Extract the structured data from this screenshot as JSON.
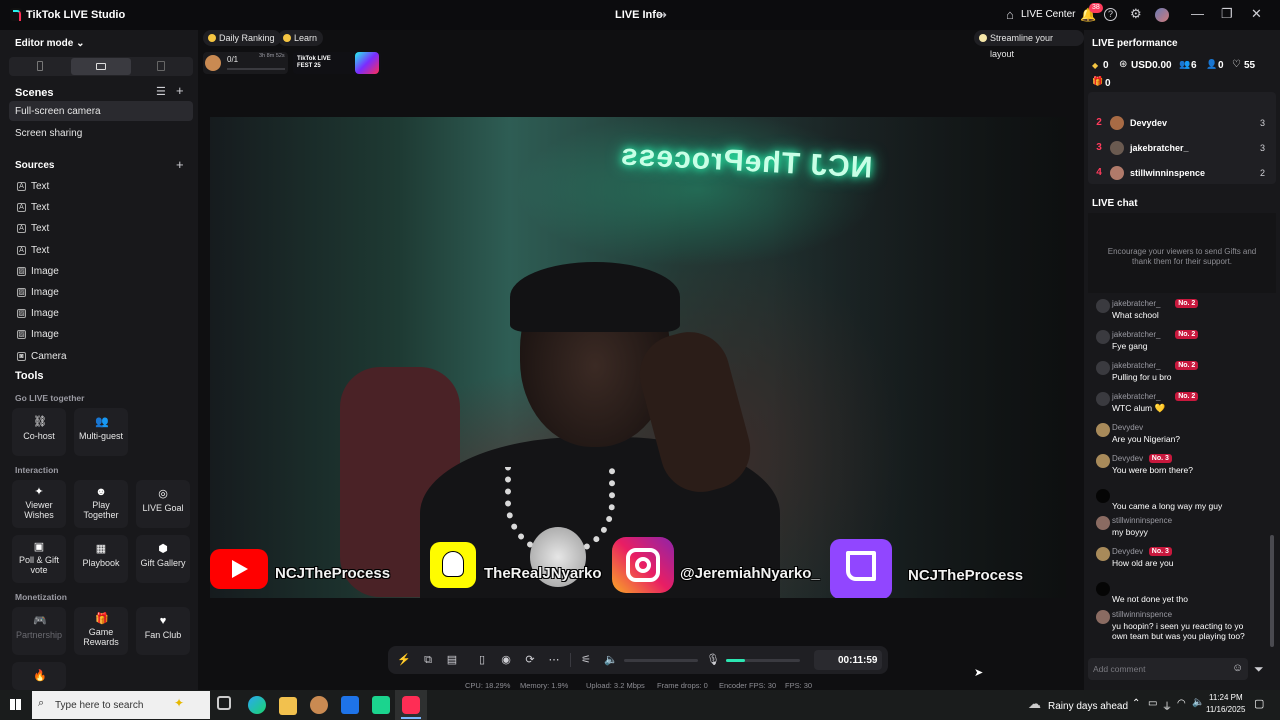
{
  "app": {
    "title": "TikTok LIVE Studio",
    "live_info": "LIVE Info",
    "live_center": "LIVE Center",
    "notif_count": "38"
  },
  "left": {
    "editor_mode": "Editor mode",
    "scenes_title": "Scenes",
    "scenes": [
      "Full-screen camera",
      "Screen sharing"
    ],
    "sources_title": "Sources",
    "sources": [
      {
        "label": "Text",
        "icon": "text-icon"
      },
      {
        "label": "Text",
        "icon": "text-icon"
      },
      {
        "label": "Text",
        "icon": "text-icon"
      },
      {
        "label": "Text",
        "icon": "text-icon"
      },
      {
        "label": "Image",
        "icon": "image-icon"
      },
      {
        "label": "Image",
        "icon": "image-icon"
      },
      {
        "label": "Image",
        "icon": "image-icon"
      },
      {
        "label": "Image",
        "icon": "image-icon"
      },
      {
        "label": "Camera",
        "icon": "camera-icon"
      }
    ],
    "tools_title": "Tools",
    "go_live_together": "Go LIVE together",
    "cohost": "Co-host",
    "multiguest": "Multi-guest",
    "interaction": "Interaction",
    "viewer_wishes": "Viewer Wishes",
    "play_together": "Play Together",
    "live_goal": "LIVE Goal",
    "poll": "Poll & Gift vote",
    "playbook": "Playbook",
    "gift_gallery": "Gift Gallery",
    "monetization": "Monetization",
    "partnership": "Partnership",
    "game_rewards": "Game Rewards",
    "fan_club": "Fan Club"
  },
  "center": {
    "daily_ranking": "Daily Ranking",
    "learn": "Learn",
    "streamline": "Streamline your layout",
    "goal_progress": "0/1",
    "goal_timer": "3h 8m 52s",
    "fest_label": "TikTok LIVE FEST 25",
    "neon_sign": "NCJ TheProcess",
    "socials": {
      "youtube": "NCJTheProcess",
      "snapchat": "TheRealJNyarko",
      "instagram": "@JeremiahNyarko_",
      "twitch": "NCJTheProcess"
    },
    "timer": "00:11:59",
    "stats": {
      "cpu": "CPU: 18.29%",
      "memory": "Memory: 1.9%",
      "upload": "Upload: 3.2 Mbps",
      "frame_drops": "Frame drops: 0",
      "encoder_fps": "Encoder FPS: 30",
      "fps": "FPS: 30"
    },
    "mic_level": 0.25
  },
  "right": {
    "perf_title": "LIVE performance",
    "perf": {
      "diamonds": "0",
      "usd": "USD0.00",
      "viewers": "6",
      "new_followers": "0",
      "likes": "55",
      "gifters": "0"
    },
    "ranking": [
      {
        "rank": "2",
        "name": "Devydev",
        "score": "3"
      },
      {
        "rank": "3",
        "name": "jakebratcher_",
        "score": "3"
      },
      {
        "rank": "4",
        "name": "stillwinninspence",
        "score": "2"
      }
    ],
    "chat_title": "LIVE chat",
    "encourage": "Encourage your viewers to send Gifts and thank them for their support.",
    "chat": [
      {
        "name": "jakebratcher_",
        "badge": "No. 2",
        "msg": "What school"
      },
      {
        "name": "jakebratcher_",
        "badge": "No. 2",
        "msg": "Fye gang"
      },
      {
        "name": "jakebratcher_",
        "badge": "No. 2",
        "msg": "Pulling for u bro"
      },
      {
        "name": "jakebratcher_",
        "badge": "No. 2",
        "msg": "WTC alum 💛"
      },
      {
        "name": "Devydev",
        "badge": "",
        "msg": "Are you Nigerian?"
      },
      {
        "name": "Devydev",
        "badge": "No. 3",
        "msg": "You were born there?"
      },
      {
        "name": "",
        "badge": "",
        "msg": "You came a long way my guy"
      },
      {
        "name": "stillwinninspence",
        "badge": "",
        "msg": "my boyyy"
      },
      {
        "name": "Devydev",
        "badge": "No. 3",
        "msg": "How old are you"
      },
      {
        "name": "",
        "badge": "",
        "msg": "We not done yet tho"
      },
      {
        "name": "stillwinninspence",
        "badge": "",
        "msg": "yu hoopin? i seen yu reacting to yo own team but was you playing too?"
      }
    ],
    "comment_placeholder": "Add comment"
  },
  "taskbar": {
    "search_placeholder": "Type here to search",
    "weather": "Rainy days ahead",
    "time": "11:24 PM",
    "date": "11/16/2025"
  },
  "colors": {
    "accent": "#ff3b5c",
    "bg": "#0f0f11",
    "panel": "#18181b",
    "youtube": "#ff0000",
    "snapchat": "#fffc00",
    "twitch": "#9146ff"
  }
}
